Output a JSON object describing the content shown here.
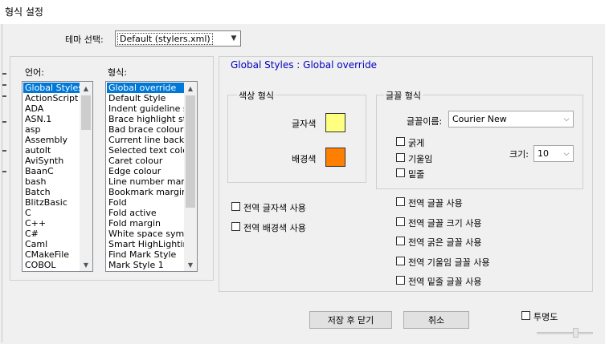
{
  "window": {
    "title": "형식 설정"
  },
  "theme": {
    "label": "테마 선택:",
    "value": "Default (stylers.xml)"
  },
  "language": {
    "label": "언어:",
    "items": [
      "Global Styles",
      "ActionScript",
      "ADA",
      "ASN.1",
      "asp",
      "Assembly",
      "autoIt",
      "AviSynth",
      "BaanC",
      "bash",
      "Batch",
      "BlitzBasic",
      "C",
      "C++",
      "C#",
      "Caml",
      "CMakeFile",
      "COBOL"
    ]
  },
  "style": {
    "label": "형식:",
    "items": [
      "Global override",
      "Default Style",
      "Indent guideline sty",
      "Brace highlight style",
      "Bad brace colour",
      "Current line backgr",
      "Selected text colour",
      "Caret colour",
      "Edge colour",
      "Line number margin",
      "Bookmark margin",
      "Fold",
      "Fold active",
      "Fold margin",
      "White space symbo",
      "Smart HighLighting",
      "Find Mark Style",
      "Mark Style 1"
    ]
  },
  "heading": "Global Styles : Global override",
  "color_group": {
    "title": "색상 형식",
    "fg_label": "글자색",
    "bg_label": "배경색",
    "fg_color": "#ffff80",
    "bg_color": "#ff8000"
  },
  "global_colors": {
    "fg": "전역 글자색 사용",
    "bg": "전역 배경색 사용"
  },
  "font_group": {
    "title": "글꼴 형식",
    "name_label": "글꼴이름:",
    "name_value": "Courier New",
    "size_label": "크기:",
    "size_value": "10",
    "bold": "굵게",
    "italic": "기울임",
    "underline": "밑줄"
  },
  "global_fonts": {
    "font": "전역 글꼴 사용",
    "size": "전역 글꼴 크기 사용",
    "bold": "전역 굵은 글꼴 사용",
    "italic": "전역 기울임 글꼴 사용",
    "underline": "전역 밑줄 글꼴 사용"
  },
  "buttons": {
    "save": "저장 후 닫기",
    "cancel": "취소"
  },
  "transparency": {
    "label": "투명도"
  }
}
